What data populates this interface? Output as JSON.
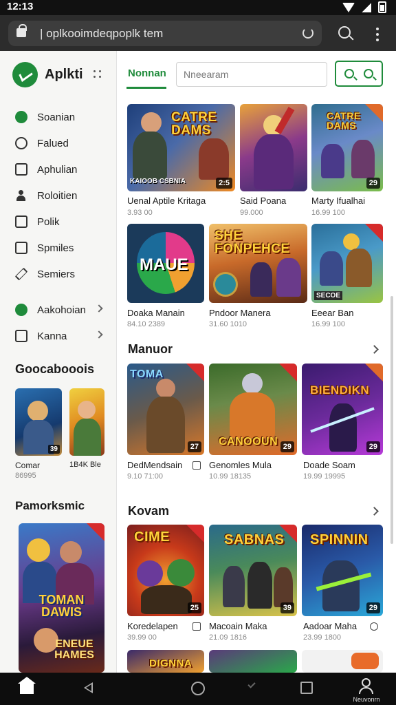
{
  "status": {
    "time": "12:13"
  },
  "browser": {
    "url": "| oplkooimdeqpoplk tem"
  },
  "sidebar": {
    "brand": "Aplkti",
    "items": [
      {
        "label": "Soanian",
        "icon": "music-icon"
      },
      {
        "label": "Falued",
        "icon": "chain-icon"
      },
      {
        "label": "Aphulian",
        "icon": "window-icon"
      },
      {
        "label": "Roloitien",
        "icon": "person-icon"
      },
      {
        "label": "Polik",
        "icon": "document-icon"
      },
      {
        "label": "Spmiles",
        "icon": "list-icon"
      },
      {
        "label": "Semiers",
        "icon": "pencil-icon"
      },
      {
        "label": "Aakohoian",
        "icon": "phone-icon"
      },
      {
        "label": "Kanna",
        "icon": "bag-icon"
      }
    ],
    "heading1": "Goocabooois",
    "cards": [
      {
        "title": "Comar",
        "sub": "86995",
        "badge": "39"
      },
      {
        "title": "1B4K Ble",
        "sub": "",
        "badge": ""
      }
    ],
    "heading2": "Pamorksmic",
    "banner": {
      "art": "TOMAN DAWIS",
      "art2": "ENEUE HAMES"
    }
  },
  "main": {
    "tab": "Nonnan",
    "search_placeholder": "Nneearam",
    "grid1": [
      {
        "art": "CATRE DAMS",
        "sub_art": "KAIOOB CSBNIA",
        "badge": "2:5",
        "title": "Uenal Aptile Kritaga",
        "sub": "3.93 00",
        "colors": [
          "#1e3f7a",
          "#f08a22"
        ]
      },
      {
        "art": "",
        "sub_art": "",
        "badge": "",
        "title": "Said Poana",
        "sub": "99.000",
        "colors": [
          "#3a2c6e",
          "#e86b2a"
        ]
      },
      {
        "art": "CATRE DAMS",
        "sub_art": "",
        "badge": "29",
        "title": "Marty Ifualhai",
        "sub": "16.99 100",
        "colors": [
          "#2f6d8e",
          "#7bbd4a"
        ]
      },
      {
        "art": "MAUE",
        "sub_art": "",
        "badge": "",
        "title": "Doaka Manain",
        "sub": "84.10 2389",
        "colors": [
          "#1b6b5a",
          "#e23a8a"
        ]
      },
      {
        "art": "SHE FONPEHCE",
        "sub_art": "",
        "badge": "",
        "title": "Pndoor Manera",
        "sub": "31.60 1010",
        "colors": [
          "#5a2a16",
          "#f4a23a"
        ]
      },
      {
        "art": "",
        "sub_art": "SECOE",
        "badge": "",
        "title": "Eeear Ban",
        "sub": "16.99 100",
        "colors": [
          "#2a6f9a",
          "#9ac441"
        ]
      }
    ],
    "section2": "Manuor",
    "grid2": [
      {
        "art": "TOMA",
        "badge": "27",
        "title": "DedMendsain",
        "sub": "9.10 71:00",
        "colors": [
          "#2a5a8a",
          "#d8782a"
        ]
      },
      {
        "art": "CANOOUN",
        "badge": "29",
        "title": "Genomles Mula",
        "sub": "10.99 18135",
        "colors": [
          "#3b6b2a",
          "#e06a2a"
        ]
      },
      {
        "art": "BIENDIKN",
        "badge": "29",
        "title": "Doade Soam",
        "sub": "19.99 19995",
        "colors": [
          "#3a1b6e",
          "#b63ad8"
        ]
      }
    ],
    "section3": "Kovam",
    "grid3": [
      {
        "art": "CIME",
        "badge": "25",
        "title": "Koredelapen",
        "sub": "39.99 00",
        "colors": [
          "#7a1e1e",
          "#f0a030"
        ]
      },
      {
        "art": "SABNAS",
        "badge": "39",
        "title": "Macoain Maka",
        "sub": "21.09 1816",
        "colors": [
          "#1f6a4a",
          "#d8c24a"
        ]
      },
      {
        "art": "SPINNIN",
        "badge": "29",
        "title": "Aadoar Maha",
        "sub": "23.99 1800",
        "colors": [
          "#1a2a6a",
          "#2aa8d8"
        ]
      }
    ],
    "grid4": [
      {
        "art": "DIGNNA",
        "colors": [
          "#3a2a6a",
          "#f0a030"
        ]
      },
      {
        "art": "",
        "colors": [
          "#5a3a7a",
          "#2aa84a"
        ]
      },
      {
        "art": "",
        "colors": [
          "#f0f0f0",
          "#e86b2a"
        ]
      }
    ]
  },
  "bottomnav": {
    "user_label": "Neuvonrn"
  },
  "colors": {
    "accent": "#1f8b3b"
  }
}
